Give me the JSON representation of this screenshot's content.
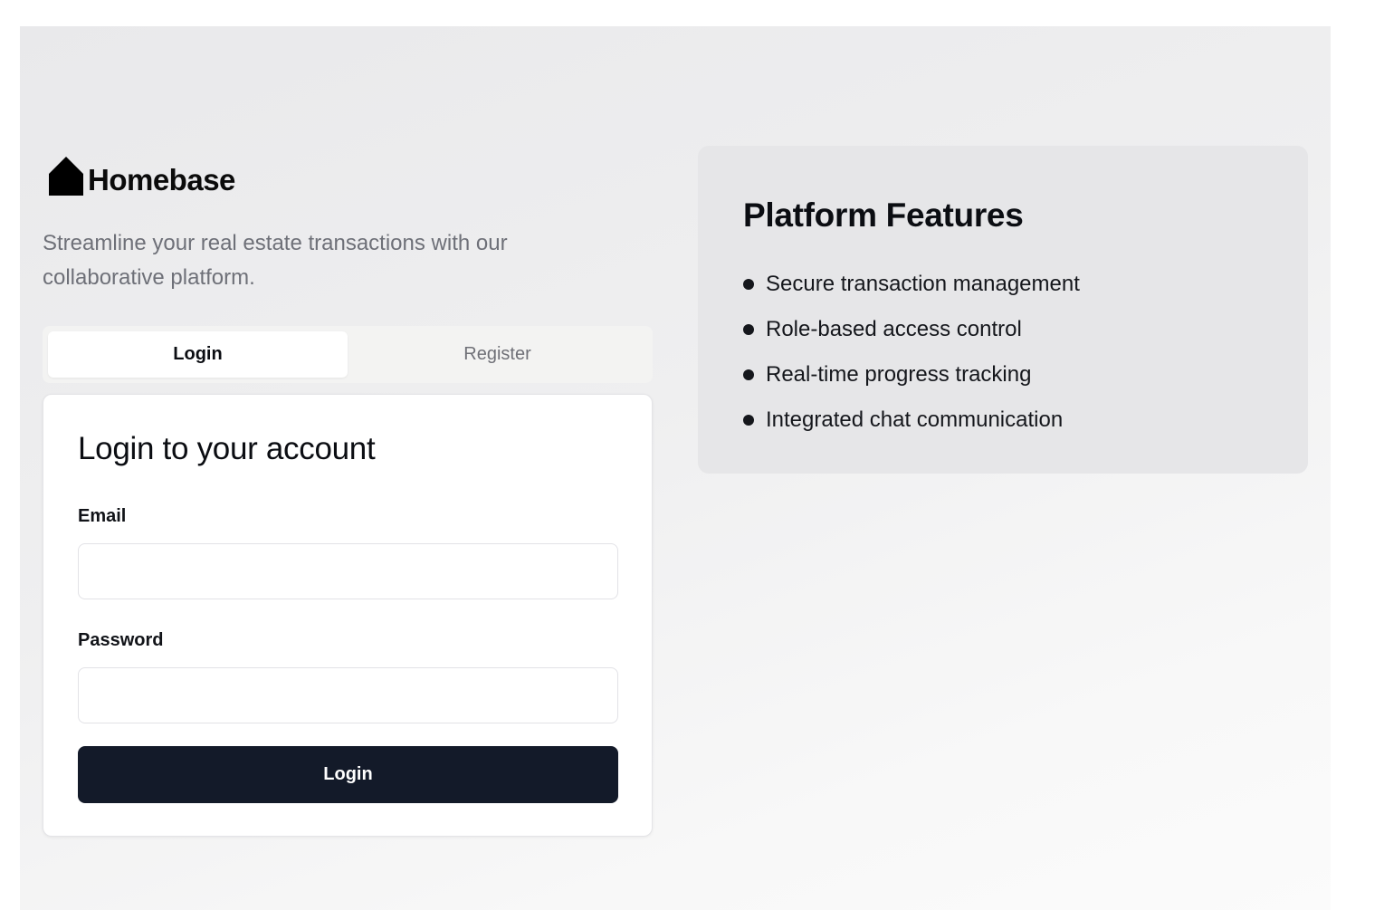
{
  "brand": {
    "name": "Homebase",
    "icon": "house-icon",
    "tagline": "Streamline your real estate transactions with our collaborative platform."
  },
  "tabs": [
    {
      "label": "Login",
      "active": true
    },
    {
      "label": "Register",
      "active": false
    }
  ],
  "login_form": {
    "title": "Login to your account",
    "email_label": "Email",
    "email_value": "",
    "password_label": "Password",
    "password_value": "",
    "submit_label": "Login"
  },
  "features": {
    "title": "Platform Features",
    "items": [
      "Secure transaction management",
      "Role-based access control",
      "Real-time progress tracking",
      "Integrated chat communication"
    ]
  },
  "colors": {
    "primary_button": "#131a29",
    "features_panel": "#e6e6e8",
    "muted_text": "#6e7078"
  }
}
